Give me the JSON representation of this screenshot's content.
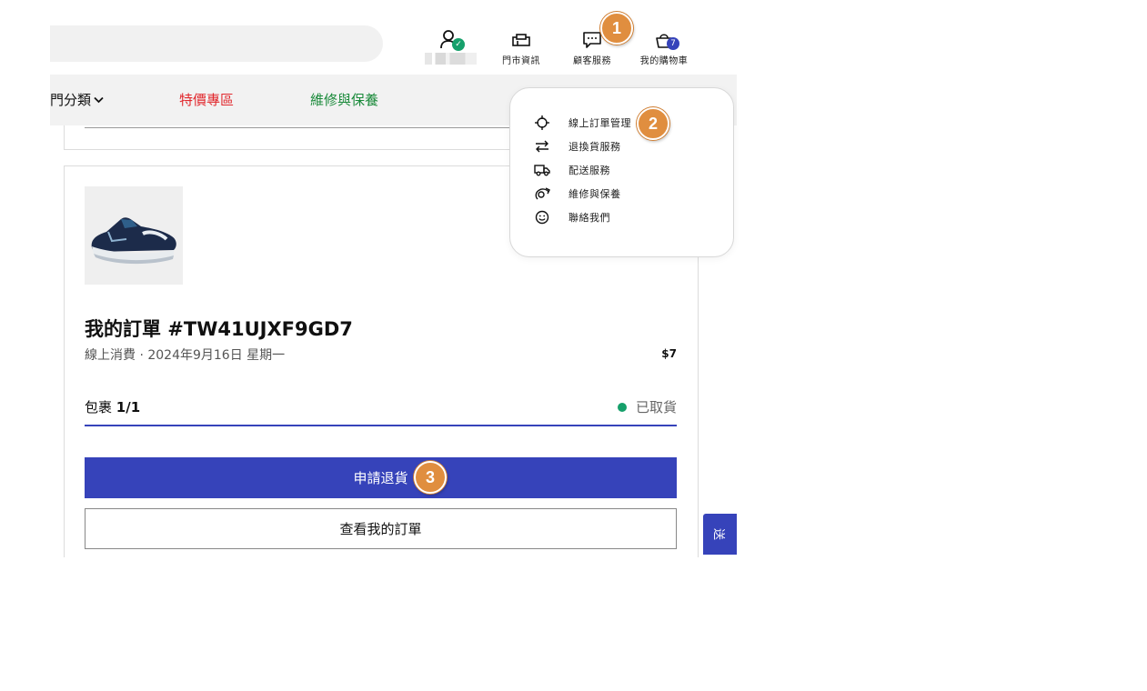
{
  "header": {
    "store_label": "門市資訊",
    "service_label": "顧客服務",
    "cart_label": "我的購物車",
    "cart_count": "7",
    "login_check": "✓"
  },
  "nav": {
    "categories_label": "門分類",
    "deals_label": "特價專區",
    "repair_label": "維修與保養",
    "deals_color": "#e1282d",
    "repair_color": "#1a8a3a"
  },
  "service_menu": {
    "items": [
      {
        "label": "線上訂單管理",
        "icon": "crosshair-icon"
      },
      {
        "label": "退換貨服務",
        "icon": "swap-arrows-icon"
      },
      {
        "label": "配送服務",
        "icon": "truck-icon"
      },
      {
        "label": "維修與保養",
        "icon": "repair-icon"
      },
      {
        "label": "聯絡我們",
        "icon": "smiley-icon"
      }
    ]
  },
  "order": {
    "title": "我的訂單 #TW41UJXF9GD7",
    "meta": "線上消費 · 2024年9月16日 星期一",
    "price": "$7",
    "package_label": "包裹",
    "package_count": "1/1",
    "status": "已取貨",
    "return_button": "申請退貨",
    "view_orders_button": "查看我的訂單"
  },
  "side_tab": {
    "label": "送"
  },
  "steps": [
    "1",
    "2",
    "3"
  ],
  "colors": {
    "brand": "#3643ba",
    "success": "#16a06b",
    "marker": "#e08e3f"
  }
}
